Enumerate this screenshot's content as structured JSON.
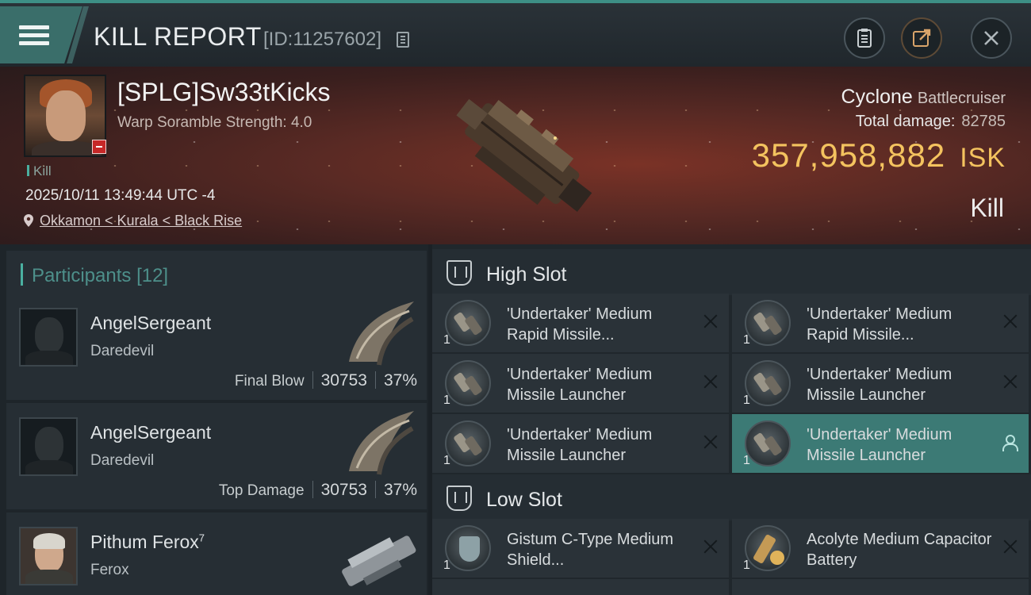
{
  "header": {
    "title": "KILL REPORT",
    "report_id": "[ID:11257602]",
    "icons": [
      "menu-icon",
      "copy-icon",
      "clipboard-icon",
      "share-icon",
      "close-icon"
    ]
  },
  "victim": {
    "pilot": "[SPLG]Sw33tKicks",
    "scramble": "Warp Soramble Strength: 4.0",
    "kill_tag": "Kill",
    "datetime": "2025/10/11 13:49:44 UTC -4",
    "location": "Okkamon < Kurala < Black Rise",
    "ship": "Cyclone",
    "ship_class": "Battlecruiser",
    "total_damage_label": "Total damage:",
    "total_damage": "82785",
    "isk_value": "357,958,882",
    "isk_unit": "ISK",
    "result": "Kill"
  },
  "participants": {
    "label": "Participants",
    "count": "[12]",
    "rows": [
      {
        "name": "AngelSergeant",
        "sup": "",
        "ship": "Daredevil",
        "label": "Final Blow",
        "damage": "30753",
        "percent": "37%"
      },
      {
        "name": "AngelSergeant",
        "sup": "",
        "ship": "Daredevil",
        "label": "Top Damage",
        "damage": "30753",
        "percent": "37%"
      },
      {
        "name": "Pithum Ferox",
        "sup": "7",
        "ship": "Ferox",
        "label": "",
        "damage": "",
        "percent": ""
      }
    ]
  },
  "slots": {
    "high": {
      "label": "High Slot",
      "modules": [
        {
          "name": "'Undertaker' Medium Rapid Missile...",
          "qty": "1"
        },
        {
          "name": "'Undertaker' Medium Rapid Missile...",
          "qty": "1"
        },
        {
          "name": "'Undertaker' Medium Missile Launcher",
          "qty": "1"
        },
        {
          "name": "'Undertaker' Medium Missile Launcher",
          "qty": "1"
        },
        {
          "name": "'Undertaker' Medium Missile Launcher",
          "qty": "1"
        },
        {
          "name": "'Undertaker' Medium Missile Launcher",
          "qty": "1"
        }
      ]
    },
    "low": {
      "label": "Low Slot",
      "modules": [
        {
          "name": "Gistum C-Type Medium Shield...",
          "qty": "1"
        },
        {
          "name": "Acolyte Medium Capacitor Battery",
          "qty": "1"
        }
      ]
    }
  },
  "colors": {
    "accent": "#3c7a75",
    "isk": "#f4c35f",
    "banner": "#5a2a24"
  }
}
